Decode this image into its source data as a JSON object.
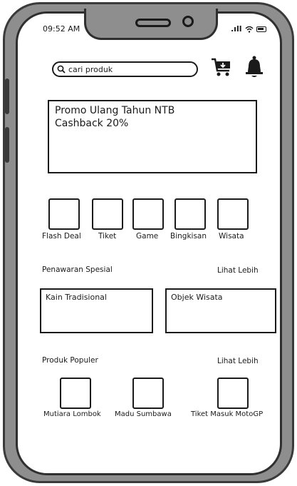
{
  "status_bar": {
    "time": "09:52 AM",
    "signal": ".ıll"
  },
  "search": {
    "placeholder": "cari produk"
  },
  "promo": {
    "line1": "Promo Ulang Tahun NTB",
    "line2": "Cashback 20%"
  },
  "categories": [
    {
      "label": "Flash Deal"
    },
    {
      "label": "Tiket"
    },
    {
      "label": "Game"
    },
    {
      "label": "Bingkisan"
    },
    {
      "label": "Wisata"
    }
  ],
  "special_offers": {
    "title": "Penawaran Spesial",
    "more": "Lihat Lebih",
    "items": [
      {
        "label": "Kain Tradisional"
      },
      {
        "label": "Objek Wisata"
      }
    ]
  },
  "popular": {
    "title": "Produk Populer",
    "more": "Lihat Lebih",
    "items": [
      {
        "label": "Mutiara Lombok"
      },
      {
        "label": "Madu Sumbawa"
      },
      {
        "label": "Tiket Masuk MotoGP"
      }
    ]
  },
  "icons": [
    "search-icon",
    "cart-icon",
    "bell-icon",
    "wifi-icon",
    "battery-icon",
    "signal-icon"
  ]
}
